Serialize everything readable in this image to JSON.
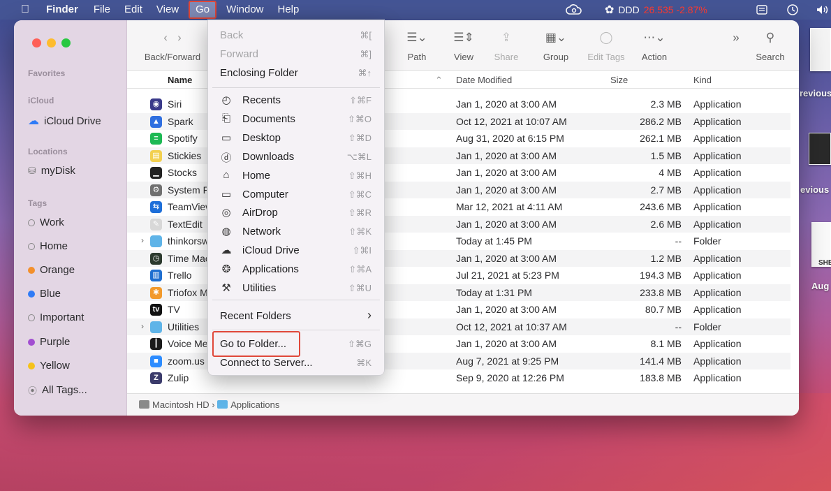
{
  "menubar": {
    "apple": "",
    "app_name": "Finder",
    "menus": [
      "File",
      "Edit",
      "View",
      "Go",
      "Window",
      "Help"
    ],
    "stock_label": "DDD",
    "stock_value": "26.535 -2.87%",
    "volume_label": "◀))"
  },
  "toolbar": {
    "back_forward_label": "Back/Forward",
    "path_label": "Path",
    "view_label": "View",
    "share_label": "Share",
    "group_label": "Group",
    "edit_tags_label": "Edit Tags",
    "action_label": "Action",
    "more_label": "»",
    "search_label": "Search"
  },
  "sidebar": {
    "favorites_header": "Favorites",
    "icloud_header": "iCloud",
    "icloud_drive": "iCloud Drive",
    "locations_header": "Locations",
    "mydisk": "myDisk",
    "tags_header": "Tags",
    "tags": [
      {
        "label": "Work",
        "color": ""
      },
      {
        "label": "Home",
        "color": ""
      },
      {
        "label": "Orange",
        "color": "#f3902c"
      },
      {
        "label": "Blue",
        "color": "#2f7bf6"
      },
      {
        "label": "Important",
        "color": ""
      },
      {
        "label": "Purple",
        "color": "#a24ed1"
      },
      {
        "label": "Yellow",
        "color": "#f5c21a"
      }
    ],
    "all_tags": "All Tags..."
  },
  "columns": {
    "name": "Name",
    "date_modified": "Date Modified",
    "size": "Size",
    "kind": "Kind"
  },
  "files": [
    {
      "name": "Siri",
      "date": "Jan 1, 2020 at 3:00 AM",
      "size": "2.3 MB",
      "kind": "Application",
      "icon_color": "#3a3a8a",
      "icon_char": "◉",
      "folder": false
    },
    {
      "name": "Spark",
      "date": "Oct 12, 2021 at 10:07 AM",
      "size": "286.2 MB",
      "kind": "Application",
      "icon_color": "#2f6fe0",
      "icon_char": "▲",
      "folder": false
    },
    {
      "name": "Spotify",
      "date": "Aug 31, 2020 at 6:15 PM",
      "size": "262.1 MB",
      "kind": "Application",
      "icon_color": "#1db954",
      "icon_char": "≡",
      "folder": false
    },
    {
      "name": "Stickies",
      "date": "Jan 1, 2020 at 3:00 AM",
      "size": "1.5 MB",
      "kind": "Application",
      "icon_color": "#f2d050",
      "icon_char": "▤",
      "folder": false
    },
    {
      "name": "Stocks",
      "date": "Jan 1, 2020 at 3:00 AM",
      "size": "4 MB",
      "kind": "Application",
      "icon_color": "#222222",
      "icon_char": "▁",
      "folder": false
    },
    {
      "name": "System Preferences",
      "date": "Jan 1, 2020 at 3:00 AM",
      "size": "2.7 MB",
      "kind": "Application",
      "icon_color": "#707070",
      "icon_char": "⚙",
      "folder": false
    },
    {
      "name": "TeamViewer",
      "date": "Mar 12, 2021 at 4:11 AM",
      "size": "243.6 MB",
      "kind": "Application",
      "icon_color": "#1e6fd9",
      "icon_char": "⇆",
      "folder": false
    },
    {
      "name": "TextEdit",
      "date": "Jan 1, 2020 at 3:00 AM",
      "size": "2.6 MB",
      "kind": "Application",
      "icon_color": "#d8d8d8",
      "icon_char": "✎",
      "folder": false
    },
    {
      "name": "thinkorswim",
      "date": "Today at 1:45 PM",
      "size": "--",
      "kind": "Folder",
      "icon_color": "#5fb4e8",
      "icon_char": "",
      "folder": true
    },
    {
      "name": "Time Machine",
      "date": "Jan 1, 2020 at 3:00 AM",
      "size": "1.2 MB",
      "kind": "Application",
      "icon_color": "#2c3a2e",
      "icon_char": "◷",
      "folder": false
    },
    {
      "name": "Trello",
      "date": "Jul 21, 2021 at 5:23 PM",
      "size": "194.3 MB",
      "kind": "Application",
      "icon_color": "#1f6fd0",
      "icon_char": "▥",
      "folder": false
    },
    {
      "name": "Triofox Mac",
      "date": "Today at 1:31 PM",
      "size": "233.8 MB",
      "kind": "Application",
      "icon_color": "#f29a2c",
      "icon_char": "✱",
      "folder": false
    },
    {
      "name": "TV",
      "date": "Jan 1, 2020 at 3:00 AM",
      "size": "80.7 MB",
      "kind": "Application",
      "icon_color": "#111111",
      "icon_char": "tv",
      "folder": false
    },
    {
      "name": "Utilities",
      "date": "Oct 12, 2021 at 10:37 AM",
      "size": "--",
      "kind": "Folder",
      "icon_color": "#5fb4e8",
      "icon_char": "",
      "folder": true
    },
    {
      "name": "Voice Memos",
      "date": "Jan 1, 2020 at 3:00 AM",
      "size": "8.1 MB",
      "kind": "Application",
      "icon_color": "#1a1a1a",
      "icon_char": "┃",
      "folder": false
    },
    {
      "name": "zoom.us",
      "date": "Aug 7, 2021 at 9:25 PM",
      "size": "141.4 MB",
      "kind": "Application",
      "icon_color": "#2d8cff",
      "icon_char": "■",
      "folder": false
    },
    {
      "name": "Zulip",
      "date": "Sep 9, 2020 at 12:26 PM",
      "size": "183.8 MB",
      "kind": "Application",
      "icon_color": "#3b3b6b",
      "icon_char": "Z",
      "folder": false
    }
  ],
  "pathbar": {
    "disk": "Macintosh HD",
    "separator": "›",
    "folder": "Applications"
  },
  "go_menu": {
    "back": {
      "label": "Back",
      "shortcut": "⌘["
    },
    "forward": {
      "label": "Forward",
      "shortcut": "⌘]"
    },
    "enclosing": {
      "label": "Enclosing Folder",
      "shortcut": "⌘↑"
    },
    "places": [
      {
        "label": "Recents",
        "shortcut": "⇧⌘F",
        "icon": "◴",
        "name": "recents"
      },
      {
        "label": "Documents",
        "shortcut": "⇧⌘O",
        "icon": "⎗",
        "name": "documents"
      },
      {
        "label": "Desktop",
        "shortcut": "⇧⌘D",
        "icon": "▭",
        "name": "desktop"
      },
      {
        "label": "Downloads",
        "shortcut": "⌥⌘L",
        "icon": "ⓓ",
        "name": "downloads"
      },
      {
        "label": "Home",
        "shortcut": "⇧⌘H",
        "icon": "⌂",
        "name": "home"
      },
      {
        "label": "Computer",
        "shortcut": "⇧⌘C",
        "icon": "▭",
        "name": "computer"
      },
      {
        "label": "AirDrop",
        "shortcut": "⇧⌘R",
        "icon": "◎",
        "name": "airdrop"
      },
      {
        "label": "Network",
        "shortcut": "⇧⌘K",
        "icon": "◍",
        "name": "network"
      },
      {
        "label": "iCloud Drive",
        "shortcut": "⇧⌘I",
        "icon": "☁",
        "name": "icloud-drive"
      },
      {
        "label": "Applications",
        "shortcut": "⇧⌘A",
        "icon": "❂",
        "name": "applications"
      },
      {
        "label": "Utilities",
        "shortcut": "⇧⌘U",
        "icon": "⚒",
        "name": "utilities"
      }
    ],
    "recent_folders": {
      "label": "Recent Folders",
      "arrow": "›"
    },
    "go_to_folder": {
      "label": "Go to Folder...",
      "shortcut": "⇧⌘G"
    },
    "connect": {
      "label": "Connect to Server...",
      "shortcut": "⌘K"
    }
  },
  "desktop": {
    "label1": "revious",
    "label2": "evious",
    "label3": "SHE",
    "label4": "Aug"
  }
}
